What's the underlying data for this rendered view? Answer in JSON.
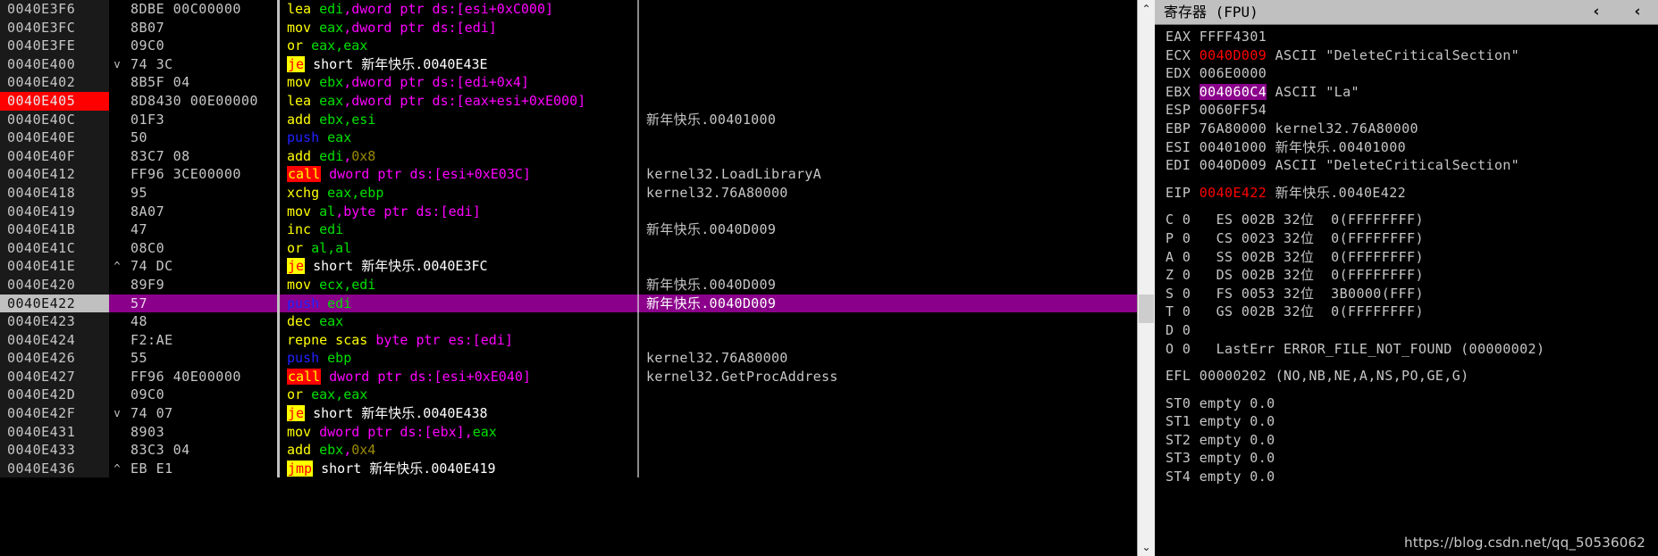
{
  "disassembly": {
    "columns": [
      "address",
      "arrow",
      "bytes",
      "instruction",
      "comment"
    ],
    "rows": [
      {
        "addr": "0040E3F6",
        "arrow": "",
        "bytes": "8DBE 00C00000",
        "ins": [
          {
            "t": "mn",
            "v": "lea"
          },
          {
            "t": "sp",
            "v": " "
          },
          {
            "t": "reg",
            "v": "edi"
          },
          {
            "t": "mem",
            "v": ",dword ptr ds:[esi+0xC000]"
          }
        ],
        "cmt": "",
        "hl": false,
        "brk": false
      },
      {
        "addr": "0040E3FC",
        "arrow": "",
        "bytes": "8B07",
        "ins": [
          {
            "t": "mn",
            "v": "mov"
          },
          {
            "t": "sp",
            "v": " "
          },
          {
            "t": "reg",
            "v": "eax"
          },
          {
            "t": "mem",
            "v": ",dword ptr ds:[edi]"
          }
        ],
        "cmt": "",
        "hl": false,
        "brk": false
      },
      {
        "addr": "0040E3FE",
        "arrow": "",
        "bytes": "09C0",
        "ins": [
          {
            "t": "mn",
            "v": "or"
          },
          {
            "t": "sp",
            "v": " "
          },
          {
            "t": "reg",
            "v": "eax,eax"
          }
        ],
        "cmt": "",
        "hl": false,
        "brk": false
      },
      {
        "addr": "0040E400",
        "arrow": "v",
        "bytes": "74 3C",
        "ins": [
          {
            "t": "jmp",
            "v": "je"
          },
          {
            "t": "sp",
            "v": " "
          },
          {
            "t": "txt",
            "v": "short 新年快乐.0040E43E"
          }
        ],
        "cmt": "",
        "hl": false,
        "brk": false
      },
      {
        "addr": "0040E402",
        "arrow": "",
        "bytes": "8B5F 04",
        "ins": [
          {
            "t": "mn",
            "v": "mov"
          },
          {
            "t": "sp",
            "v": " "
          },
          {
            "t": "reg",
            "v": "ebx"
          },
          {
            "t": "mem",
            "v": ",dword ptr ds:[edi+0x4]"
          }
        ],
        "cmt": "",
        "hl": false,
        "brk": false
      },
      {
        "addr": "0040E405",
        "arrow": "",
        "bytes": "8D8430 00E00000",
        "ins": [
          {
            "t": "mn",
            "v": "lea"
          },
          {
            "t": "sp",
            "v": " "
          },
          {
            "t": "reg",
            "v": "eax"
          },
          {
            "t": "mem",
            "v": ",dword ptr ds:[eax+esi+0xE000]"
          }
        ],
        "cmt": "",
        "hl": false,
        "brk": true
      },
      {
        "addr": "0040E40C",
        "arrow": "",
        "bytes": "01F3",
        "ins": [
          {
            "t": "mn",
            "v": "add"
          },
          {
            "t": "sp",
            "v": " "
          },
          {
            "t": "reg",
            "v": "ebx,esi"
          }
        ],
        "cmt": "新年快乐.00401000",
        "hl": false,
        "brk": false
      },
      {
        "addr": "0040E40E",
        "arrow": "",
        "bytes": "50",
        "ins": [
          {
            "t": "push",
            "v": "push"
          },
          {
            "t": "sp",
            "v": " "
          },
          {
            "t": "reg",
            "v": "eax"
          }
        ],
        "cmt": "",
        "hl": false,
        "brk": false
      },
      {
        "addr": "0040E40F",
        "arrow": "",
        "bytes": "83C7 08",
        "ins": [
          {
            "t": "mn",
            "v": "add"
          },
          {
            "t": "sp",
            "v": " "
          },
          {
            "t": "reg",
            "v": "edi"
          },
          {
            "t": "txt2",
            "v": ","
          },
          {
            "t": "num",
            "v": "0x8"
          }
        ],
        "cmt": "",
        "hl": false,
        "brk": false
      },
      {
        "addr": "0040E412",
        "arrow": "",
        "bytes": "FF96 3CE00000",
        "ins": [
          {
            "t": "call",
            "v": "call"
          },
          {
            "t": "sp",
            "v": " "
          },
          {
            "t": "mem",
            "v": "dword ptr ds:[esi+0xE03C]"
          }
        ],
        "cmt": "kernel32.LoadLibraryA",
        "hl": false,
        "brk": false
      },
      {
        "addr": "0040E418",
        "arrow": "",
        "bytes": "95",
        "ins": [
          {
            "t": "mn",
            "v": "xchg"
          },
          {
            "t": "sp",
            "v": " "
          },
          {
            "t": "reg",
            "v": "eax,ebp"
          }
        ],
        "cmt": "kernel32.76A80000",
        "hl": false,
        "brk": false
      },
      {
        "addr": "0040E419",
        "arrow": "",
        "bytes": "8A07",
        "ins": [
          {
            "t": "mn",
            "v": "mov"
          },
          {
            "t": "sp",
            "v": " "
          },
          {
            "t": "reg",
            "v": "al"
          },
          {
            "t": "mem",
            "v": ",byte ptr ds:[edi]"
          }
        ],
        "cmt": "",
        "hl": false,
        "brk": false
      },
      {
        "addr": "0040E41B",
        "arrow": "",
        "bytes": "47",
        "ins": [
          {
            "t": "mn",
            "v": "inc"
          },
          {
            "t": "sp",
            "v": " "
          },
          {
            "t": "reg",
            "v": "edi"
          }
        ],
        "cmt": "新年快乐.0040D009",
        "hl": false,
        "brk": false
      },
      {
        "addr": "0040E41C",
        "arrow": "",
        "bytes": "08C0",
        "ins": [
          {
            "t": "mn",
            "v": "or"
          },
          {
            "t": "sp",
            "v": " "
          },
          {
            "t": "reg",
            "v": "al,al"
          }
        ],
        "cmt": "",
        "hl": false,
        "brk": false
      },
      {
        "addr": "0040E41E",
        "arrow": "^",
        "bytes": "74 DC",
        "ins": [
          {
            "t": "jmp",
            "v": "je"
          },
          {
            "t": "sp",
            "v": " "
          },
          {
            "t": "txt",
            "v": "short 新年快乐.0040E3FC"
          }
        ],
        "cmt": "",
        "hl": false,
        "brk": false
      },
      {
        "addr": "0040E420",
        "arrow": "",
        "bytes": "89F9",
        "ins": [
          {
            "t": "mn",
            "v": "mov"
          },
          {
            "t": "sp",
            "v": " "
          },
          {
            "t": "reg",
            "v": "ecx,edi"
          }
        ],
        "cmt": "新年快乐.0040D009",
        "hl": false,
        "brk": false
      },
      {
        "addr": "0040E422",
        "arrow": "",
        "bytes": "57",
        "ins": [
          {
            "t": "push",
            "v": "push"
          },
          {
            "t": "sp",
            "v": " "
          },
          {
            "t": "reg",
            "v": "edi"
          }
        ],
        "cmt": "新年快乐.0040D009",
        "hl": true,
        "brk": false
      },
      {
        "addr": "0040E423",
        "arrow": "",
        "bytes": "48",
        "ins": [
          {
            "t": "mn",
            "v": "dec"
          },
          {
            "t": "sp",
            "v": " "
          },
          {
            "t": "reg",
            "v": "eax"
          }
        ],
        "cmt": "",
        "hl": false,
        "brk": false
      },
      {
        "addr": "0040E424",
        "arrow": "",
        "bytes": "F2:AE",
        "ins": [
          {
            "t": "mn",
            "v": "repne scas"
          },
          {
            "t": "sp",
            "v": " "
          },
          {
            "t": "mem",
            "v": "byte ptr es:[edi]"
          }
        ],
        "cmt": "",
        "hl": false,
        "brk": false
      },
      {
        "addr": "0040E426",
        "arrow": "",
        "bytes": "55",
        "ins": [
          {
            "t": "push",
            "v": "push"
          },
          {
            "t": "sp",
            "v": " "
          },
          {
            "t": "reg",
            "v": "ebp"
          }
        ],
        "cmt": "kernel32.76A80000",
        "hl": false,
        "brk": false
      },
      {
        "addr": "0040E427",
        "arrow": "",
        "bytes": "FF96 40E00000",
        "ins": [
          {
            "t": "call",
            "v": "call"
          },
          {
            "t": "sp",
            "v": " "
          },
          {
            "t": "mem",
            "v": "dword ptr ds:[esi+0xE040]"
          }
        ],
        "cmt": "kernel32.GetProcAddress",
        "hl": false,
        "brk": false
      },
      {
        "addr": "0040E42D",
        "arrow": "",
        "bytes": "09C0",
        "ins": [
          {
            "t": "mn",
            "v": "or"
          },
          {
            "t": "sp",
            "v": " "
          },
          {
            "t": "reg",
            "v": "eax,eax"
          }
        ],
        "cmt": "",
        "hl": false,
        "brk": false
      },
      {
        "addr": "0040E42F",
        "arrow": "v",
        "bytes": "74 07",
        "ins": [
          {
            "t": "jmp",
            "v": "je"
          },
          {
            "t": "sp",
            "v": " "
          },
          {
            "t": "txt",
            "v": "short 新年快乐.0040E438"
          }
        ],
        "cmt": "",
        "hl": false,
        "brk": false
      },
      {
        "addr": "0040E431",
        "arrow": "",
        "bytes": "8903",
        "ins": [
          {
            "t": "mn",
            "v": "mov"
          },
          {
            "t": "sp",
            "v": " "
          },
          {
            "t": "mem",
            "v": "dword ptr ds:[ebx]"
          },
          {
            "t": "txt2",
            "v": ","
          },
          {
            "t": "reg",
            "v": "eax"
          }
        ],
        "cmt": "",
        "hl": false,
        "brk": false
      },
      {
        "addr": "0040E433",
        "arrow": "",
        "bytes": "83C3 04",
        "ins": [
          {
            "t": "mn",
            "v": "add"
          },
          {
            "t": "sp",
            "v": " "
          },
          {
            "t": "reg",
            "v": "ebx"
          },
          {
            "t": "txt2",
            "v": ","
          },
          {
            "t": "num",
            "v": "0x4"
          }
        ],
        "cmt": "",
        "hl": false,
        "brk": false
      },
      {
        "addr": "0040E436",
        "arrow": "^",
        "bytes": "EB E1",
        "ins": [
          {
            "t": "jmp",
            "v": "jmp"
          },
          {
            "t": "sp",
            "v": " "
          },
          {
            "t": "txt",
            "v": "short 新年快乐.0040E419"
          }
        ],
        "cmt": "",
        "hl": false,
        "brk": false
      }
    ],
    "scrollbar": {
      "up_arrow": "⌃",
      "down_arrow": "⌄"
    }
  },
  "registers": {
    "title": "寄存器 (FPU)",
    "chevron_left_1": "‹",
    "chevron_left_2": "‹",
    "general": [
      {
        "name": "EAX",
        "value": "FFFF4301",
        "comment": "",
        "state": "normal"
      },
      {
        "name": "ECX",
        "value": "0040D009",
        "comment": "ASCII \"DeleteCriticalSection\"",
        "state": "changed"
      },
      {
        "name": "EDX",
        "value": "006E0000",
        "comment": "",
        "state": "normal"
      },
      {
        "name": "EBX",
        "value": "004060C4",
        "comment": "ASCII \"La\"",
        "state": "highlighted"
      },
      {
        "name": "ESP",
        "value": "0060FF54",
        "comment": "",
        "state": "normal"
      },
      {
        "name": "EBP",
        "value": "76A80000",
        "comment": "kernel32.76A80000",
        "state": "normal"
      },
      {
        "name": "ESI",
        "value": "00401000",
        "comment": "新年快乐.00401000",
        "state": "normal"
      },
      {
        "name": "EDI",
        "value": "0040D009",
        "comment": "ASCII \"DeleteCriticalSection\"",
        "state": "normal"
      }
    ],
    "eip": {
      "name": "EIP",
      "value": "0040E422",
      "comment": "新年快乐.0040E422",
      "state": "changed"
    },
    "flags": [
      {
        "flag": "C",
        "bit": "0",
        "seg": "ES",
        "sel": "002B",
        "mode": "32位",
        "base": "0(FFFFFFFF)"
      },
      {
        "flag": "P",
        "bit": "0",
        "seg": "CS",
        "sel": "0023",
        "mode": "32位",
        "base": "0(FFFFFFFF)"
      },
      {
        "flag": "A",
        "bit": "0",
        "seg": "SS",
        "sel": "002B",
        "mode": "32位",
        "base": "0(FFFFFFFF)"
      },
      {
        "flag": "Z",
        "bit": "0",
        "seg": "DS",
        "sel": "002B",
        "mode": "32位",
        "base": "0(FFFFFFFF)"
      },
      {
        "flag": "S",
        "bit": "0",
        "seg": "FS",
        "sel": "0053",
        "mode": "32位",
        "base": "3B0000(FFF)"
      },
      {
        "flag": "T",
        "bit": "0",
        "seg": "GS",
        "sel": "002B",
        "mode": "32位",
        "base": "0(FFFFFFFF)"
      },
      {
        "flag": "D",
        "bit": "0",
        "seg": "",
        "sel": "",
        "mode": "",
        "base": ""
      },
      {
        "flag": "O",
        "bit": "0",
        "seg": "",
        "sel": "",
        "mode": "",
        "base": "",
        "lasterr_label": "LastErr",
        "lasterr": "ERROR_FILE_NOT_FOUND (00000002)"
      }
    ],
    "efl": {
      "label": "EFL",
      "value": "00000202",
      "flags": "(NO,NB,NE,A,NS,PO,GE,G)"
    },
    "fpu": [
      {
        "name": "ST0",
        "status": "empty",
        "value": "0.0"
      },
      {
        "name": "ST1",
        "status": "empty",
        "value": "0.0"
      },
      {
        "name": "ST2",
        "status": "empty",
        "value": "0.0"
      },
      {
        "name": "ST3",
        "status": "empty",
        "value": "0.0"
      },
      {
        "name": "ST4",
        "status": "empty",
        "value": "0.0"
      }
    ]
  },
  "watermark": "https://blog.csdn.net/qq_50536062",
  "colors": {
    "mnemonic": "#ffff00",
    "register": "#00e000",
    "memory": "#ff00ff",
    "push": "#2222ff",
    "jump_bg": "#ffff00",
    "jump_fg": "#ff0000",
    "call_bg": "#ff0000",
    "call_fg": "#ffff00",
    "breakpoint_bg": "#ff0000",
    "selection_bg": "#8B008B",
    "changed_reg": "#ff0000",
    "background": "#000000",
    "text": "#c6c6c6"
  }
}
